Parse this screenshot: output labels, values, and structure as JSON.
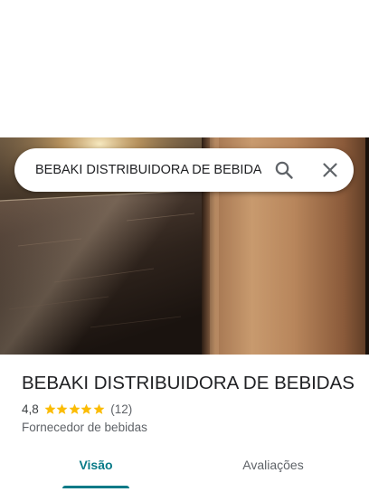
{
  "search": {
    "query": "BEBAKI DISTRIBUIDORA DE BEBIDAS",
    "search_icon": "search-icon",
    "close_icon": "close-icon"
  },
  "place": {
    "hero_image": "storefront-photo",
    "title": "BEBAKI DISTRIBUIDORA DE BEBIDAS",
    "rating": "4,8",
    "stars_filled": 5,
    "stars_total": 5,
    "review_count": "(12)",
    "category": "Fornecedor de bebidas"
  },
  "tabs": [
    {
      "label": "Visão geral",
      "active": true
    },
    {
      "label": "Avaliações",
      "active": false
    }
  ],
  "colors": {
    "accent": "#087a87",
    "star": "#fbbc04",
    "text_primary": "#202124",
    "text_secondary": "#5f6368"
  }
}
